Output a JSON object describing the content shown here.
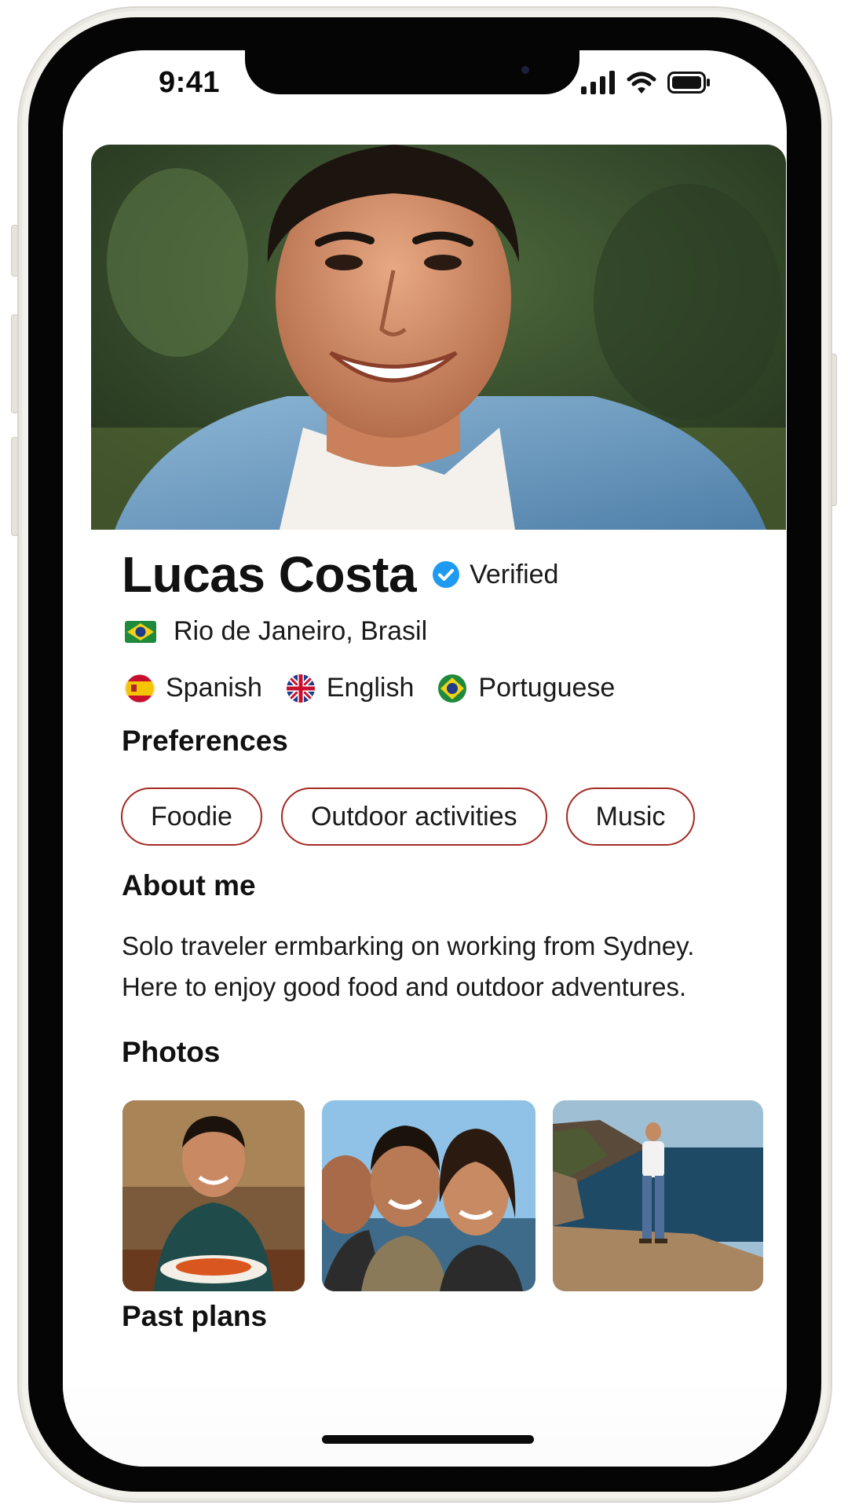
{
  "status_bar": {
    "time": "9:41"
  },
  "profile": {
    "name": "Lucas Costa",
    "verified_label": "Verified",
    "location": "Rio de Janeiro, Brasil",
    "languages": [
      {
        "label": "Spanish",
        "flag": "spain-flag-icon"
      },
      {
        "label": "English",
        "flag": "uk-flag-icon"
      },
      {
        "label": "Portuguese",
        "flag": "brazil-flag-icon"
      }
    ]
  },
  "preferences": {
    "title": "Preferences",
    "chips": [
      "Foodie",
      "Outdoor activities",
      "Music"
    ]
  },
  "about": {
    "title": "About me",
    "lines": [
      "Solo traveler ermbarking on working from Sydney.",
      "Here to enjoy good food and outdoor adventures."
    ]
  },
  "photos": {
    "title": "Photos"
  },
  "past_plans": {
    "title": "Past plans"
  },
  "colors": {
    "chip_border": "#a32a22",
    "verified_blue": "#1e9bf0",
    "text": "#1a1a1a"
  }
}
